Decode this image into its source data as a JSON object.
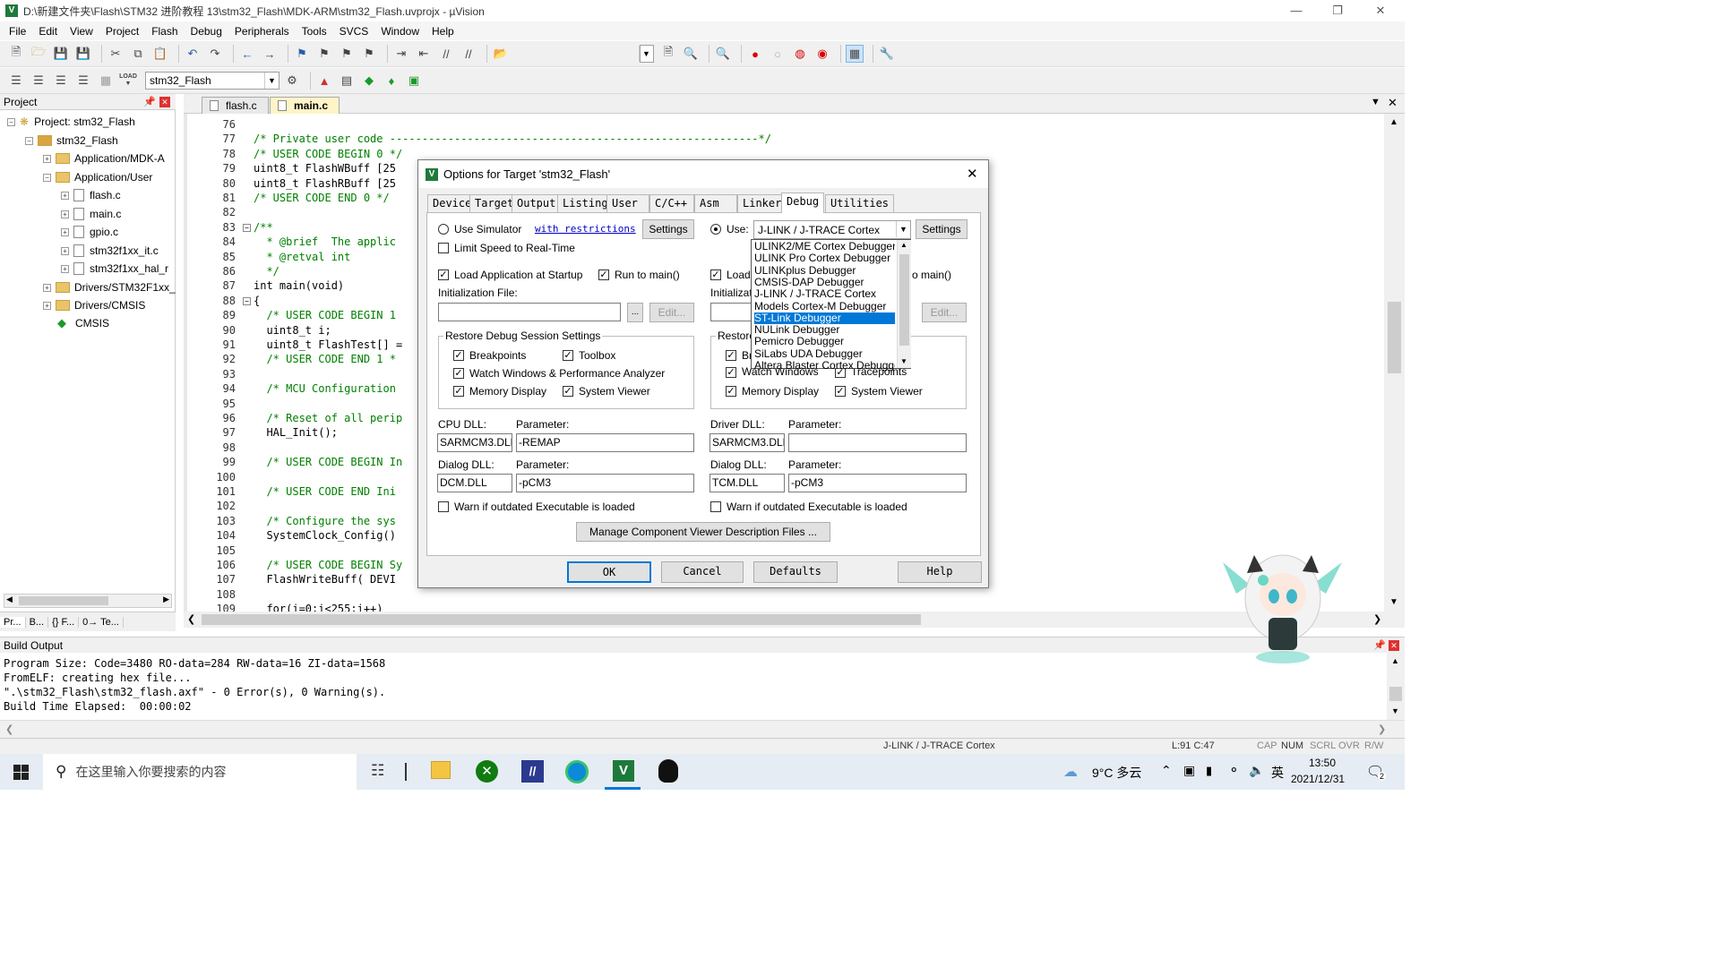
{
  "window": {
    "title": "D:\\新建文件夹\\Flash\\STM32 进阶教程 13\\stm32_Flash\\MDK-ARM\\stm32_Flash.uvprojx - µVision",
    "minimize": "—",
    "restore": "❐",
    "close": "✕"
  },
  "menu": [
    "File",
    "Edit",
    "View",
    "Project",
    "Flash",
    "Debug",
    "Peripherals",
    "Tools",
    "SVCS",
    "Window",
    "Help"
  ],
  "toolbar2": {
    "target": "stm32_Flash",
    "load_label": "LOAD"
  },
  "project": {
    "header": "Project",
    "root": "Project: stm32_Flash",
    "target": "stm32_Flash",
    "groups": [
      {
        "label": "Application/MDK-A"
      },
      {
        "label": "Application/User"
      }
    ],
    "files": [
      "flash.c",
      "main.c",
      "gpio.c",
      "stm32f1xx_it.c",
      "stm32f1xx_hal_r"
    ],
    "other": [
      "Drivers/STM32F1xx_",
      "Drivers/CMSIS",
      "CMSIS"
    ],
    "tabs": [
      "Pr...",
      "B...",
      "{} F...",
      "0→ Te..."
    ]
  },
  "editor": {
    "tabs": [
      "flash.c",
      "main.c"
    ],
    "lines": [
      {
        "n": "76",
        "t": ""
      },
      {
        "n": "77",
        "t": "/* Private user code ---------------------------------------------------------*/",
        "c": "cm"
      },
      {
        "n": "78",
        "t": "/* USER CODE BEGIN 0 */",
        "c": "cm"
      },
      {
        "n": "79",
        "t": "uint8_t FlashWBuff [25"
      },
      {
        "n": "80",
        "t": "uint8_t FlashRBuff [25"
      },
      {
        "n": "81",
        "t": "/* USER CODE END 0 */",
        "c": "cm"
      },
      {
        "n": "82",
        "t": ""
      },
      {
        "n": "83",
        "t": "/**",
        "c": "cm"
      },
      {
        "n": "84",
        "t": "  * @brief  The applic",
        "c": "cm"
      },
      {
        "n": "85",
        "t": "  * @retval int",
        "c": "cm"
      },
      {
        "n": "86",
        "t": "  */",
        "c": "cm"
      },
      {
        "n": "87",
        "t": "int main(void)"
      },
      {
        "n": "88",
        "t": "{"
      },
      {
        "n": "89",
        "t": "  /* USER CODE BEGIN 1",
        "c": "cm"
      },
      {
        "n": "90",
        "t": "  uint8_t i;"
      },
      {
        "n": "91",
        "t": "  uint8_t FlashTest[] ="
      },
      {
        "n": "92",
        "t": "  /* USER CODE END 1 *",
        "c": "cm"
      },
      {
        "n": "93",
        "t": ""
      },
      {
        "n": "94",
        "t": "  /* MCU Configuration",
        "c": "cm"
      },
      {
        "n": "95",
        "t": ""
      },
      {
        "n": "96",
        "t": "  /* Reset of all perip",
        "c": "cm"
      },
      {
        "n": "97",
        "t": "  HAL_Init();"
      },
      {
        "n": "98",
        "t": ""
      },
      {
        "n": "99",
        "t": "  /* USER CODE BEGIN In",
        "c": "cm"
      },
      {
        "n": "100",
        "t": ""
      },
      {
        "n": "101",
        "t": "  /* USER CODE END Ini",
        "c": "cm"
      },
      {
        "n": "102",
        "t": ""
      },
      {
        "n": "103",
        "t": "  /* Configure the sys",
        "c": "cm"
      },
      {
        "n": "104",
        "t": "  SystemClock_Config()"
      },
      {
        "n": "105",
        "t": ""
      },
      {
        "n": "106",
        "t": "  /* USER CODE BEGIN Sy",
        "c": "cm"
      },
      {
        "n": "107",
        "t": "  FlashWriteBuff( DEVI"
      },
      {
        "n": "108",
        "t": ""
      },
      {
        "n": "109",
        "t": "  for(i=0;i<255;i++)"
      }
    ]
  },
  "build": {
    "header": "Build Output",
    "lines": [
      "Program Size: Code=3480 RO-data=284 RW-data=16 ZI-data=1568",
      "FromELF: creating hex file...",
      "\".\\stm32_Flash\\stm32_flash.axf\" - 0 Error(s), 0 Warning(s).",
      "Build Time Elapsed:  00:00:02"
    ]
  },
  "status": {
    "debugger": "J-LINK / J-TRACE Cortex",
    "pos": "L:91 C:47",
    "cap": "CAP",
    "num": "NUM",
    "scrl": "SCRL",
    "ovr": "OVR",
    "rw": "R/W"
  },
  "dialog": {
    "title": "Options for Target 'stm32_Flash'",
    "tabs": [
      "Device",
      "Target",
      "Output",
      "Listing",
      "User",
      "C/C++",
      "Asm",
      "Linker",
      "Debug",
      "Utilities"
    ],
    "active_tab": "Debug",
    "left": {
      "use_simulator": "Use Simulator",
      "with_restrictions": "with restrictions",
      "settings": "Settings",
      "limit_speed": "Limit Speed to Real-Time",
      "load_app": "Load Application at Startup",
      "run_main": "Run to main()",
      "init_file": "Initialization File:",
      "browse": "...",
      "edit": "Edit...",
      "restore": "Restore Debug Session Settings",
      "breakpoints": "Breakpoints",
      "toolbox": "Toolbox",
      "watch": "Watch Windows & Performance Analyzer",
      "memory": "Memory Display",
      "sysviewer": "System Viewer",
      "cpu_dll_label": "CPU DLL:",
      "cpu_param_label": "Parameter:",
      "cpu_dll": "SARMCM3.DLL",
      "cpu_param": "-REMAP",
      "dialog_dll_label": "Dialog DLL:",
      "dialog_param_label": "Parameter:",
      "dialog_dll": "DCM.DLL",
      "dialog_param": "-pCM3",
      "warn": "Warn if outdated Executable is loaded"
    },
    "right": {
      "use": "Use:",
      "debugger": "J-LINK / J-TRACE Cortex",
      "settings": "Settings",
      "load": "Load",
      "run_main_partial": "o main()",
      "init_partial": "Initializatio",
      "edit": "Edit...",
      "restore_partial": "Restore",
      "breakpoints_partial": "Bre",
      "watch": "Watch Windows",
      "tracepoints": "Tracepoints",
      "memory": "Memory Display",
      "sysviewer": "System Viewer",
      "driver_dll_label": "Driver DLL:",
      "driver_param_label": "Parameter:",
      "driver_dll": "SARMCM3.DLL",
      "driver_param": "",
      "dialog_dll_label": "Dialog DLL:",
      "dialog_param_label": "Parameter:",
      "dialog_dll": "TCM.DLL",
      "dialog_param": "-pCM3",
      "warn": "Warn if outdated Executable is loaded"
    },
    "dropdown_options": [
      "ULINK2/ME Cortex Debugger",
      "ULINK Pro Cortex Debugger",
      "ULINKplus Debugger",
      "CMSIS-DAP Debugger",
      "J-LINK / J-TRACE Cortex",
      "Models Cortex-M Debugger",
      "ST-Link Debugger",
      "NULink Debugger",
      "Pemicro Debugger",
      "SiLabs UDA Debugger",
      "Altera Blaster Cortex Debugger"
    ],
    "dropdown_selected": "ST-Link Debugger",
    "manage": "Manage Component Viewer Description Files ...",
    "ok": "OK",
    "cancel": "Cancel",
    "defaults": "Defaults",
    "help": "Help"
  },
  "taskbar": {
    "search_placeholder": "在这里输入你要搜索的内容",
    "weather": "9°C 多云",
    "time": "13:50",
    "date": "2021/12/31",
    "ime": "英",
    "notif_count": "2"
  },
  "colors": {
    "accent": "#0078d7",
    "comment": "#008000",
    "keyword": "#0000ff"
  }
}
